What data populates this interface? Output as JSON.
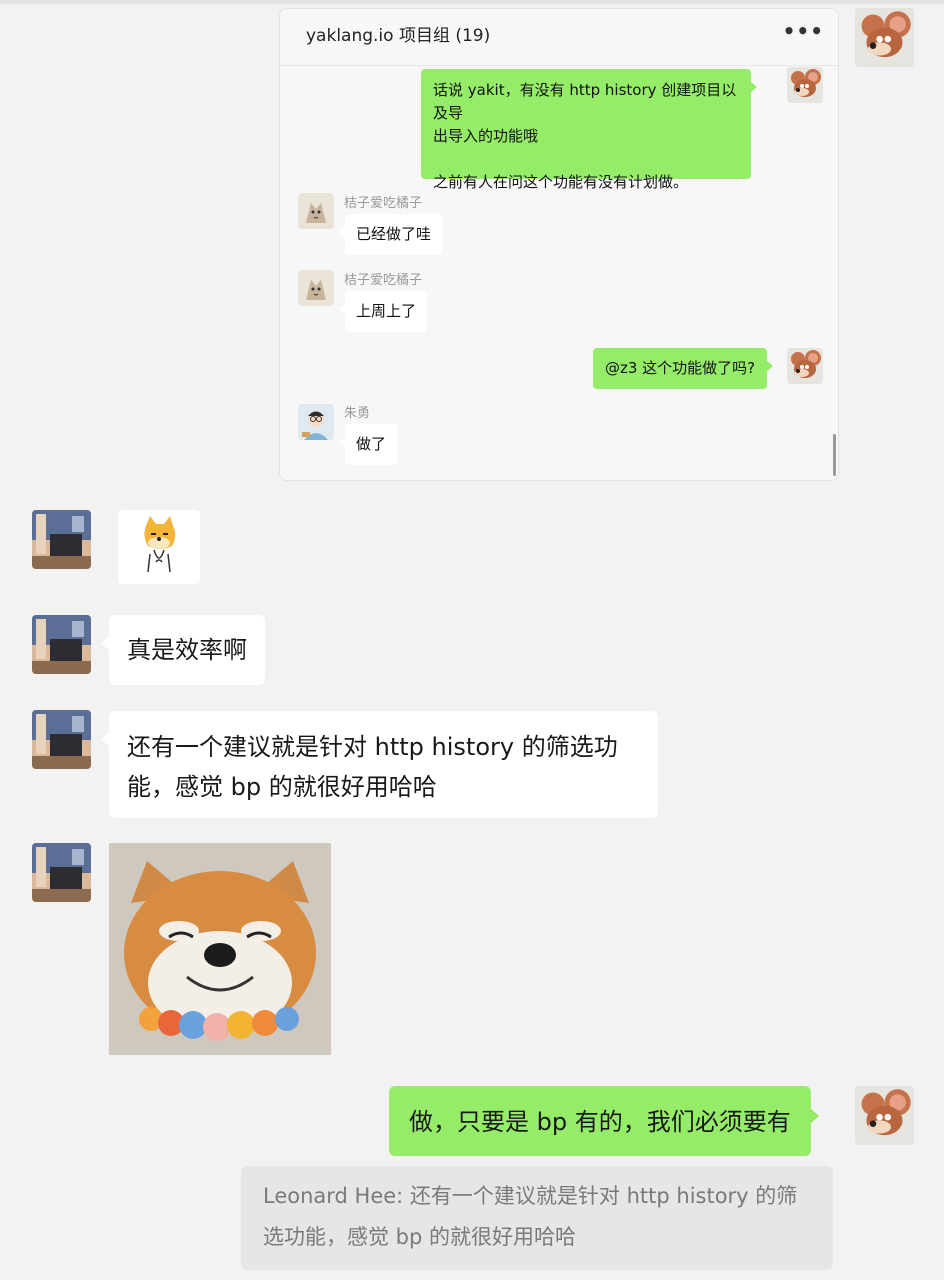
{
  "forwarded_chat": {
    "title": "yaklang.io 项目组 (19)",
    "more_icon": "more-horizontal-icon",
    "messages": [
      {
        "sender": "",
        "side": "right",
        "line1": "话说 yakit，有没有 http history 创建项目以及导",
        "line2": "出导入的功能哦",
        "line3": "之前有人在问这个功能有没有计划做。"
      },
      {
        "sender": "桔子爱吃橘子",
        "side": "left",
        "text": "已经做了哇"
      },
      {
        "sender": "桔子爱吃橘子",
        "side": "left",
        "text": "上周上了"
      },
      {
        "sender": "",
        "side": "right",
        "text": "@z3 这个功能做了吗?"
      },
      {
        "sender": "朱勇",
        "side": "left",
        "text": "做了"
      }
    ]
  },
  "chat": {
    "messages": [
      {
        "side": "left",
        "type": "sticker",
        "sticker": "doge-sticker"
      },
      {
        "side": "left",
        "type": "text",
        "text": "真是效率啊"
      },
      {
        "side": "left",
        "type": "text",
        "line1": "还有一个建议就是针对 http history 的筛选功",
        "line2": "能，感觉 bp 的就很好用哈哈"
      },
      {
        "side": "left",
        "type": "image",
        "image": "shiba-dog-photo"
      },
      {
        "side": "right",
        "type": "text",
        "text": "做，只要是 bp 有的，我们必须要有"
      }
    ],
    "quote": {
      "line1": "Leonard Hee: 还有一个建议就是针对 http history 的筛",
      "line2": "选功能，感觉 bp 的就很好用哈哈"
    }
  },
  "colors": {
    "green_bubble": "#95ec69",
    "background": "#f2f2f2",
    "white_bubble": "#ffffff",
    "quote_bg": "#e6e6e6"
  }
}
